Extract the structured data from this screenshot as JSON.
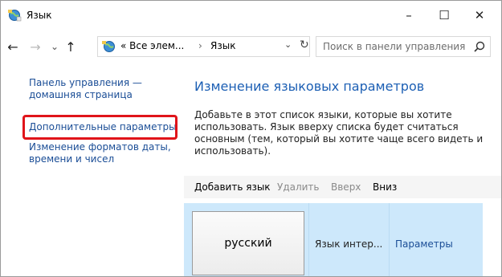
{
  "window": {
    "title": "Язык",
    "minimize_glyph": "–",
    "maximize_glyph": "☐",
    "close_glyph": "✕"
  },
  "nav": {
    "back_glyph": "←",
    "forward_glyph": "→",
    "recent_glyph": "⌄",
    "up_glyph": "↑",
    "breadcrumb": [
      "« Все элем...",
      "›",
      "Язык"
    ],
    "dropdown_glyph": "⌄",
    "refresh_glyph": "↻",
    "search_placeholder": "Поиск в панели управления"
  },
  "sidebar": {
    "home_label_line1": "Панель управления —",
    "home_label_line2": "домашняя страница",
    "advanced_label": "Дополнительные параметры",
    "formats_label_line1": "Изменение форматов даты,",
    "formats_label_line2": "времени и чисел"
  },
  "main": {
    "title": "Изменение языковых параметров",
    "description_lines": [
      "Добавьте в этот список языки, которые вы хотите",
      "использовать. Язык вверху списка будет считаться",
      "основным (тем, который вы хотите чаще всего видеть и",
      "использовать)."
    ],
    "toolbar": {
      "add_label": "Добавить язык",
      "remove_label": "Удалить",
      "up_label": "Вверх",
      "down_label": "Вниз"
    },
    "language_row": {
      "name": "русский",
      "interface_status": "Язык интер...",
      "options_label": "Параметры"
    }
  },
  "colors": {
    "link": "#1a4d96",
    "title_blue": "#1c5fb4",
    "highlight_border": "#e0141a",
    "row_selected": "#cde8fb",
    "disabled_text": "#8a8a8a"
  },
  "icons": {
    "title": "control-panel-globe-icon",
    "address": "control-panel-globe-icon",
    "search": "magnifier-icon"
  }
}
